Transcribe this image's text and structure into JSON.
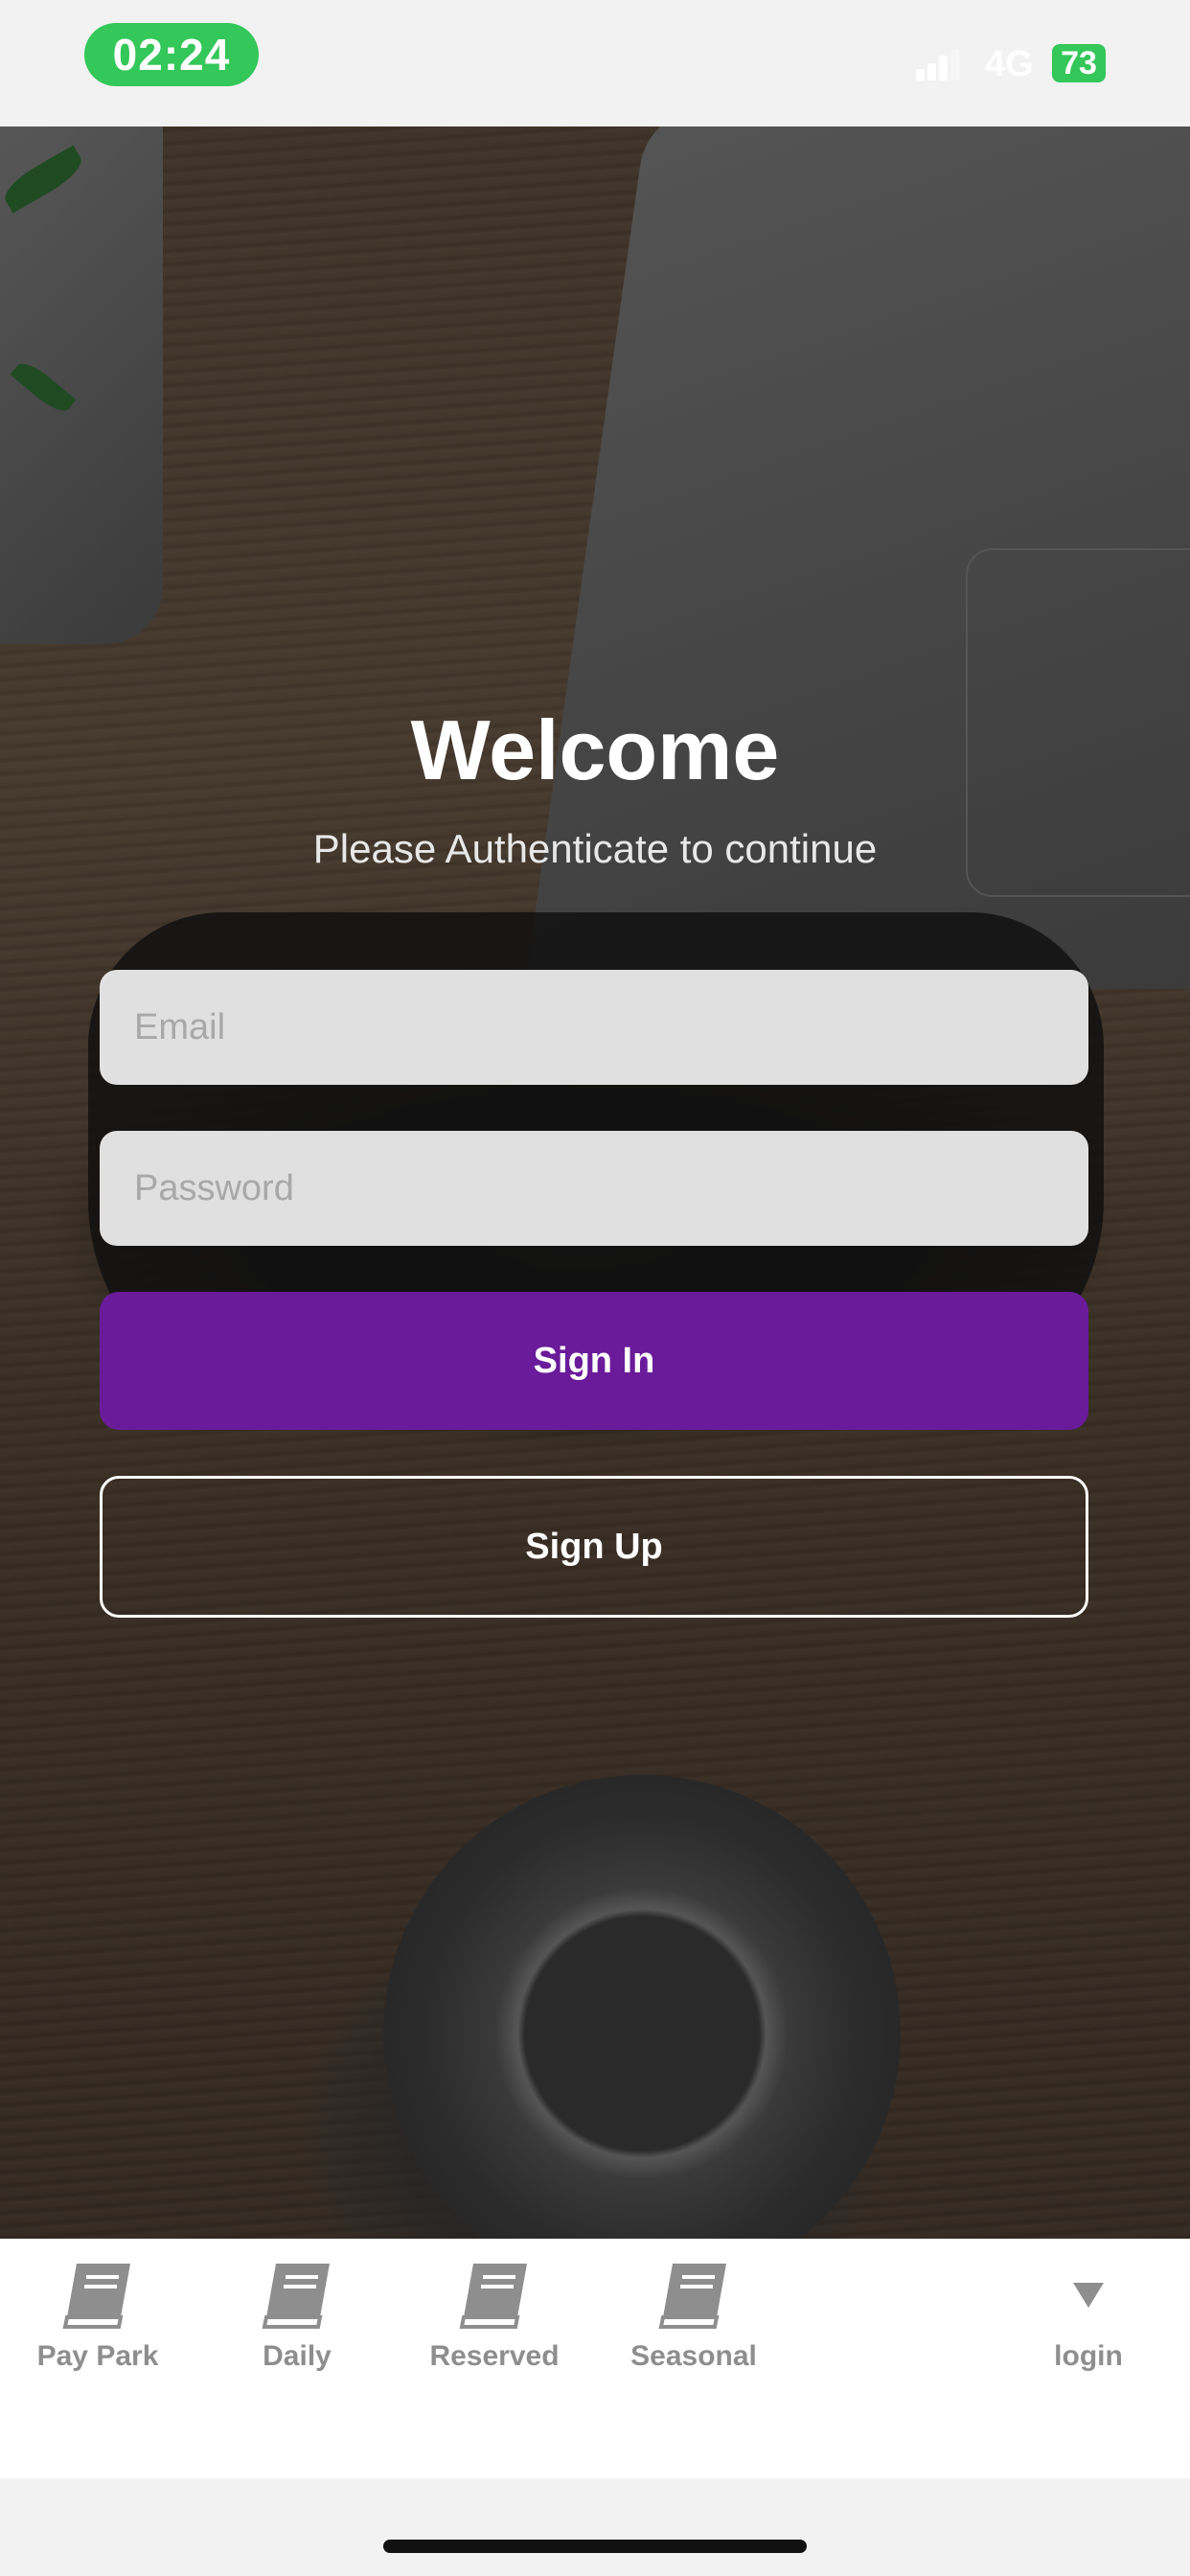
{
  "status_bar": {
    "time": "02:24",
    "network": "4G",
    "battery": "73"
  },
  "login": {
    "title": "Welcome",
    "subtitle": "Please Authenticate to continue",
    "email_placeholder": "Email",
    "password_placeholder": "Password",
    "sign_in_label": "Sign In",
    "sign_up_label": "Sign Up"
  },
  "tab_bar": {
    "items": [
      {
        "label": "Pay Park",
        "icon": "book-icon"
      },
      {
        "label": "Daily",
        "icon": "book-icon"
      },
      {
        "label": "Reserved",
        "icon": "book-icon"
      },
      {
        "label": "Seasonal",
        "icon": "book-icon"
      },
      {
        "label": "login",
        "icon": "triangle-down-icon"
      }
    ]
  },
  "colors": {
    "accent": "#6a1b9a",
    "status_green": "#34c759",
    "tab_inactive": "#8e8e8e"
  }
}
